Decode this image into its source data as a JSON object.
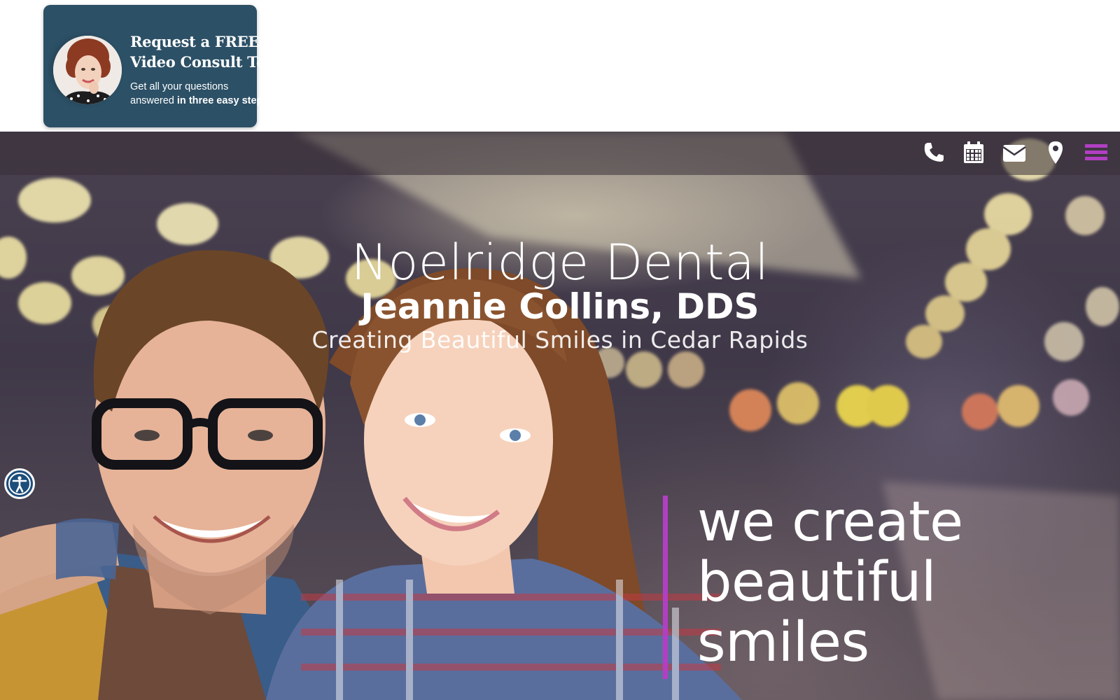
{
  "promo": {
    "title_line1": "Request a FREE",
    "title_line2": "Video Consult Today",
    "sub_line1": "Get all your questions",
    "sub_line2_plain": "answered ",
    "sub_line2_bold": "in three easy steps!"
  },
  "nav": {
    "icons": [
      "phone-icon",
      "calendar-icon",
      "envelope-icon",
      "map-pin-icon",
      "hamburger-menu-icon"
    ],
    "accent_color": "#b23fc3"
  },
  "hero": {
    "practice_name": "Noelridge Dental",
    "doctor_name": "Jeannie Collins, DDS",
    "tagline": "Creating Beautiful Smiles in Cedar Rapids",
    "slogan_line1": "we create",
    "slogan_line2": "beautiful",
    "slogan_line3": "smiles"
  },
  "colors": {
    "promo_card": "#2c5066",
    "accent": "#b23fc3",
    "accessibility": "#1d4d7a"
  }
}
